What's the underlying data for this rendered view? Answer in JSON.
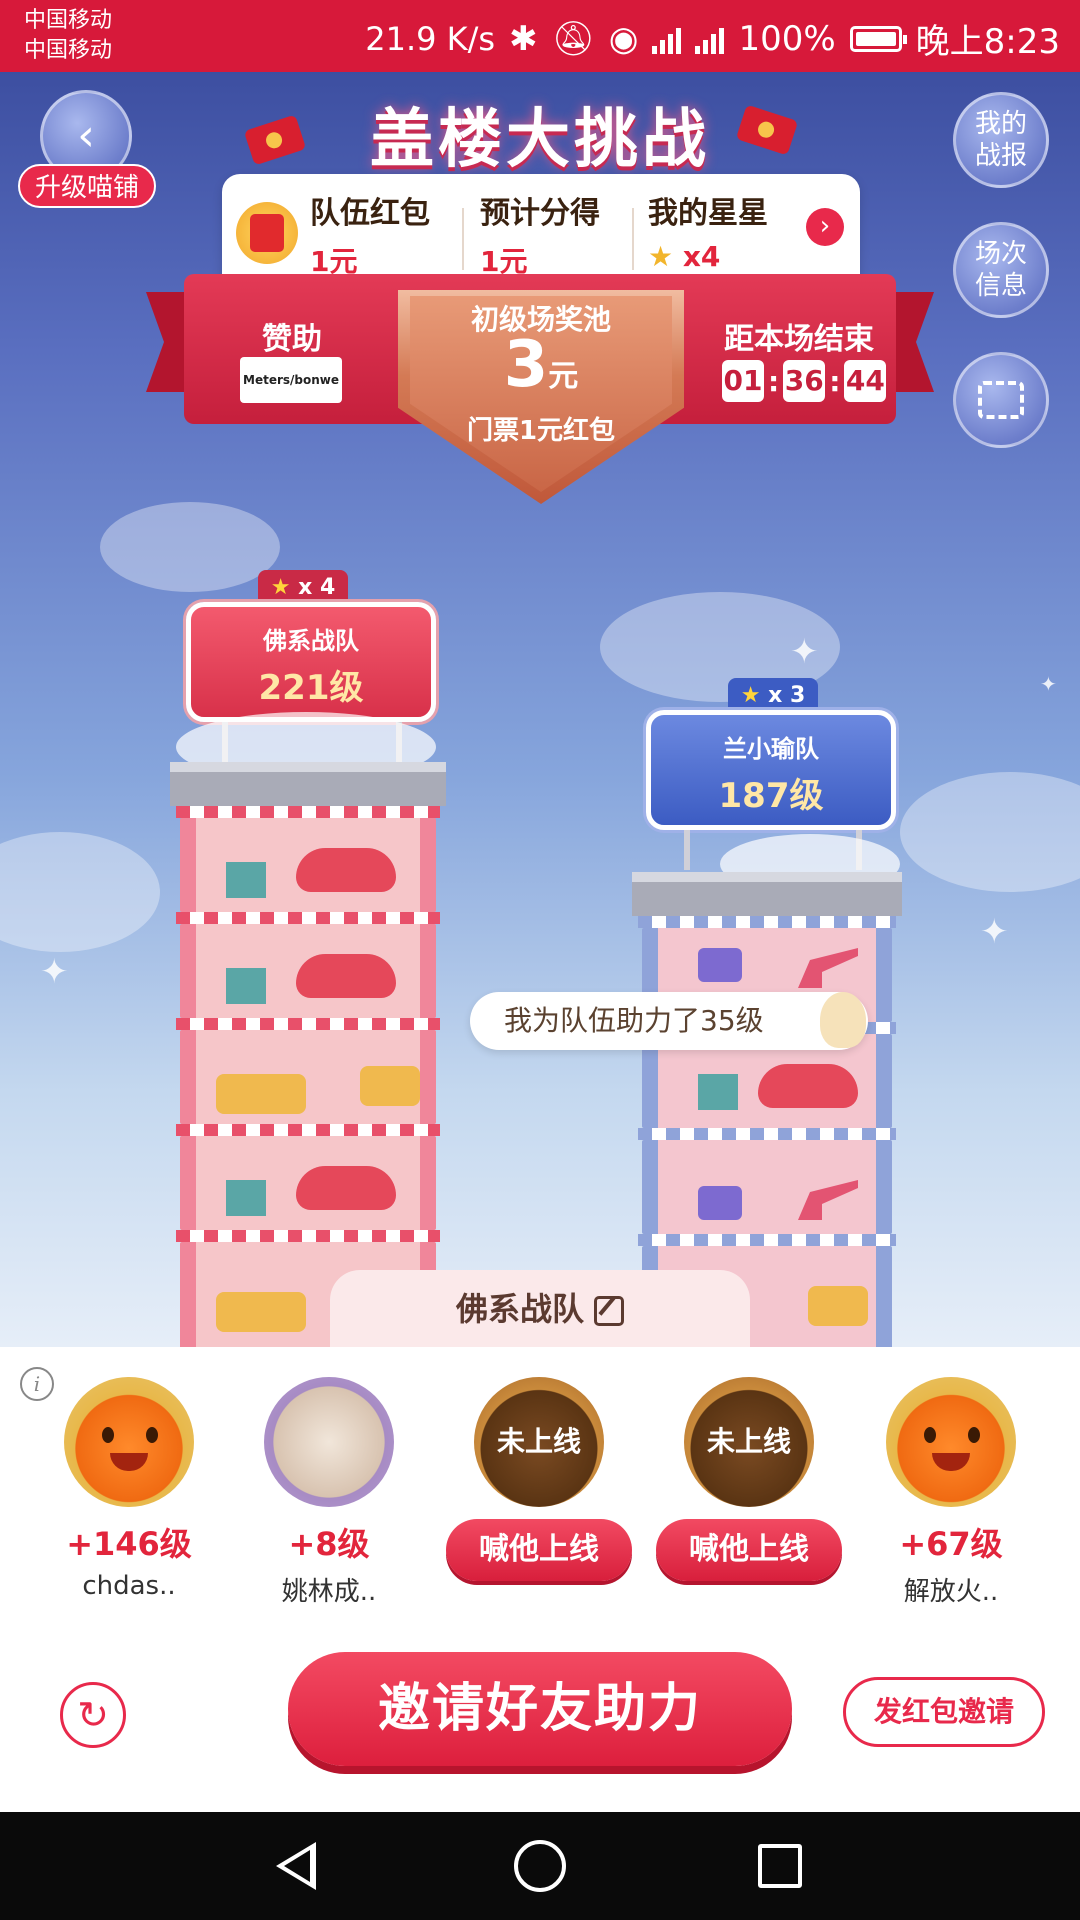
{
  "status": {
    "carrier1": "中国移动",
    "carrier2": "中国移动",
    "speed": "21.9 K/s",
    "battery": "100%",
    "time": "晚上8:23"
  },
  "header": {
    "title": "盖楼大挑战",
    "upgrade": "升级喵铺",
    "my_report": "我的\n战报",
    "session_info": "场次\n信息"
  },
  "info_card": {
    "team_redpack_label": "队伍红包",
    "team_redpack_value": "1元",
    "expected_label": "预计分得",
    "expected_value": "1元",
    "stars_label": "我的星星",
    "stars_value": "x4"
  },
  "pool": {
    "sponsor_label": "赞助",
    "sponsor_logo_text": "Meters/bonwe",
    "title": "初级场奖池",
    "amount": "3",
    "unit": "元",
    "ticket": "门票1元红包",
    "end_label": "距本场结束",
    "timer": [
      "01",
      "36",
      "44"
    ]
  },
  "towers": {
    "left": {
      "stars": "x 4",
      "team": "佛系战队",
      "level": "221级"
    },
    "right": {
      "stars": "x 3",
      "team": "兰小瑜队",
      "level": "187级"
    }
  },
  "bubble": "我为队伍助力了35级",
  "team_tab": "佛系战队",
  "members": [
    {
      "gain": "+146级",
      "name": "chdas..",
      "status": "online"
    },
    {
      "gain": "+8级",
      "name": "姚林成..",
      "status": "online"
    },
    {
      "offline_text": "未上线",
      "action": "喊他上线",
      "status": "offline"
    },
    {
      "offline_text": "未上线",
      "action": "喊他上线",
      "status": "offline"
    },
    {
      "gain": "+67级",
      "name": "解放火..",
      "status": "online"
    }
  ],
  "actions": {
    "invite": "邀请好友助力",
    "redpack_invite": "发红包邀请"
  },
  "colors": {
    "brand_red": "#e8294b",
    "status_bar": "#d7193a"
  }
}
